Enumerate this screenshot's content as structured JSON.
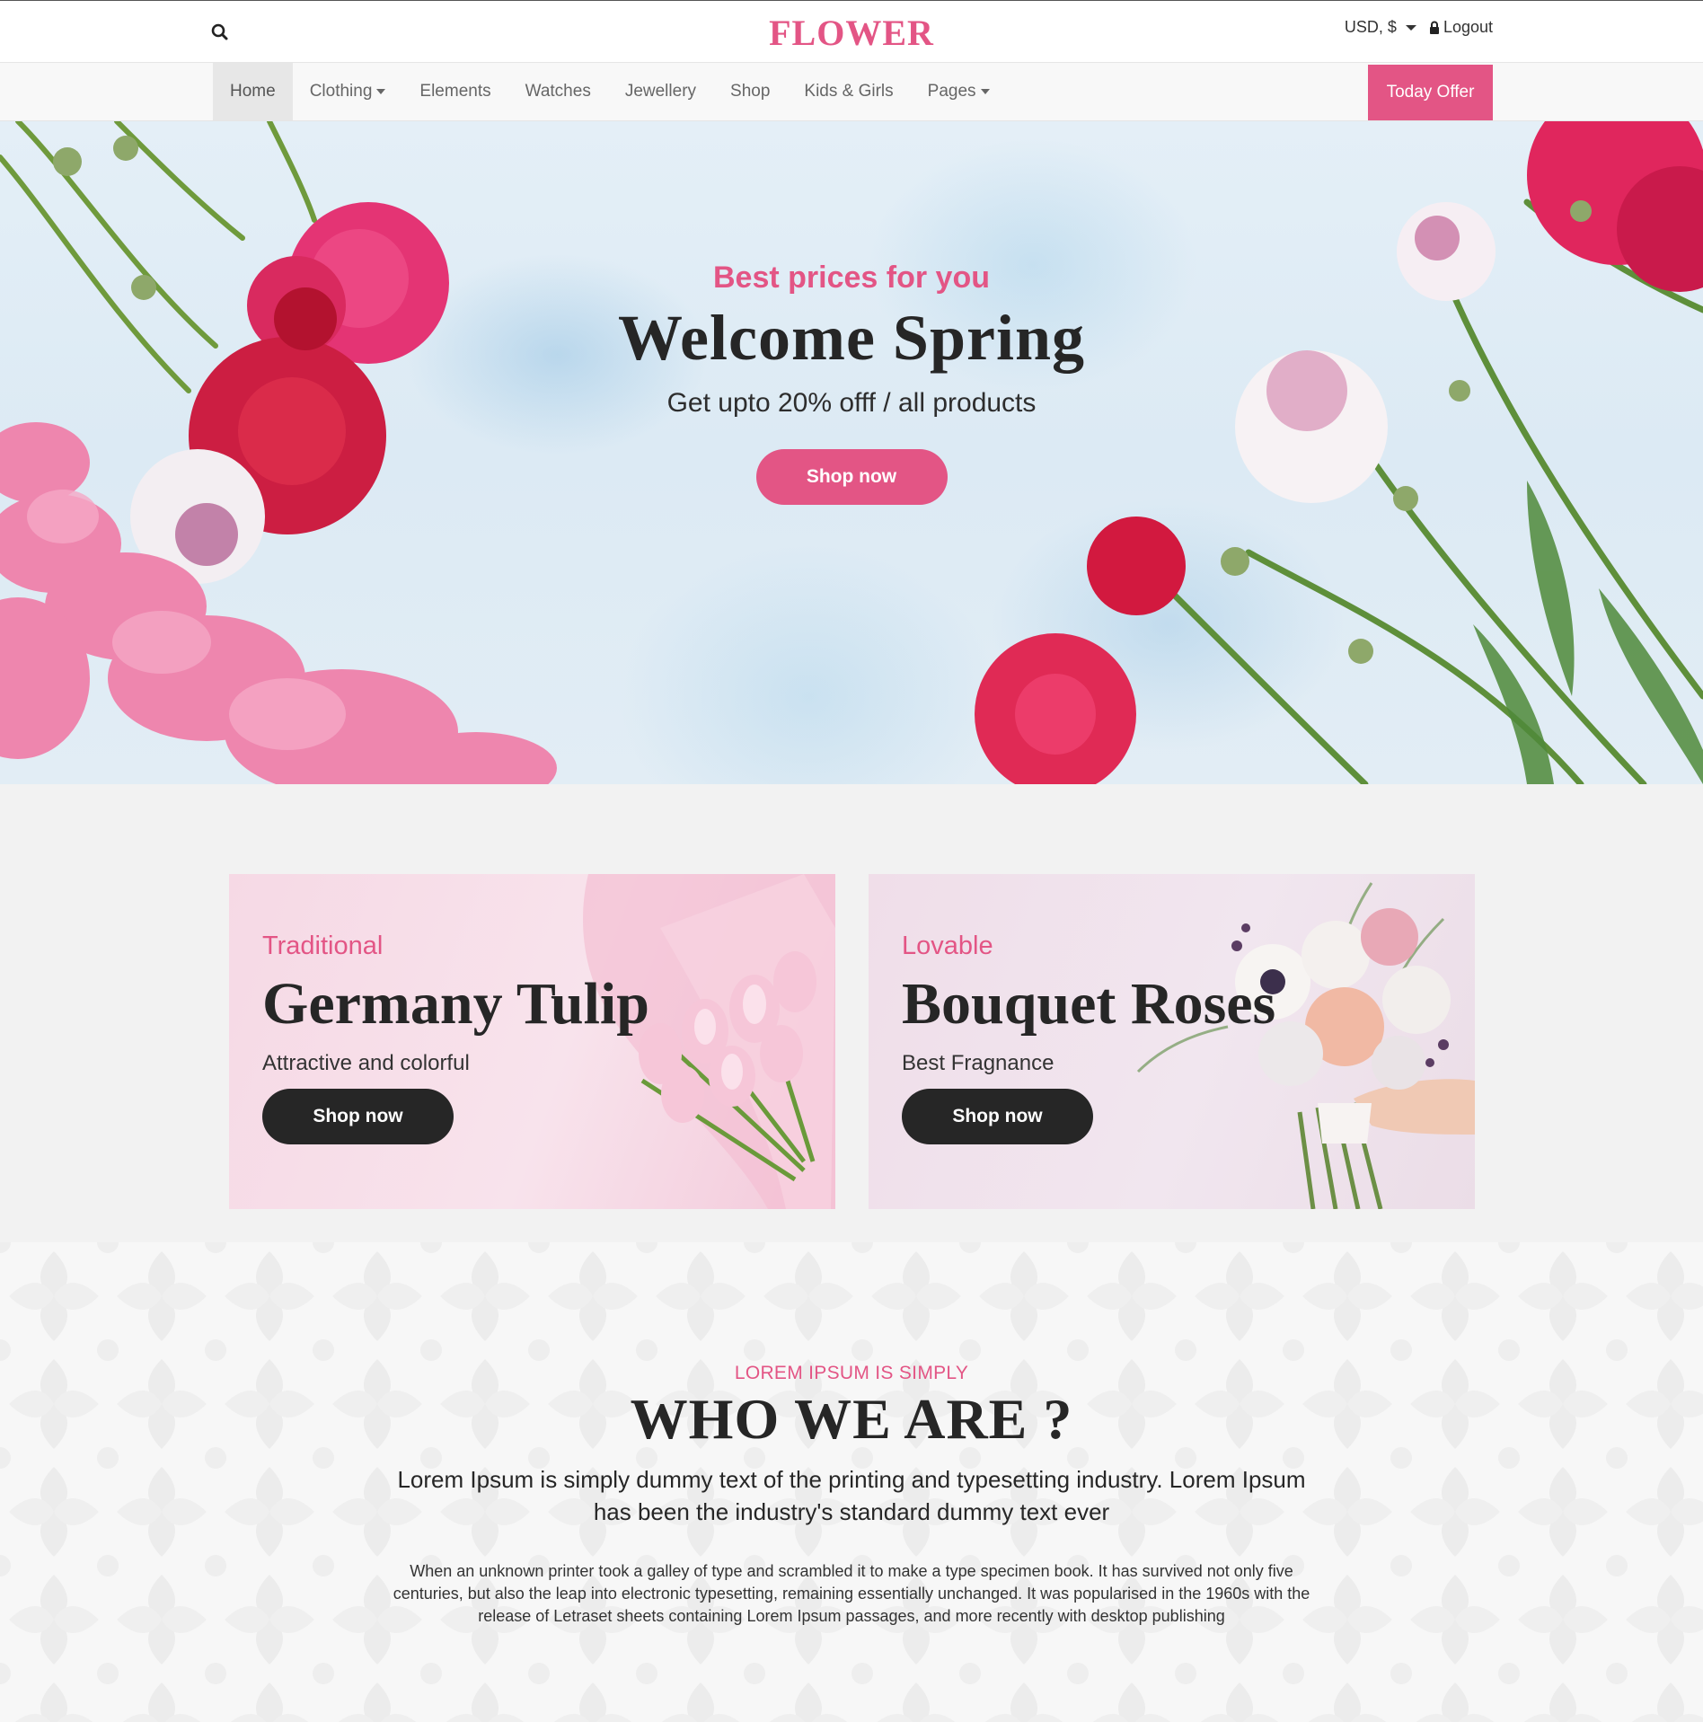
{
  "header": {
    "logo": "FLOWER",
    "currency_label": "USD, $",
    "logout_label": "Logout",
    "icons": {
      "search": "search-icon",
      "currency_dropdown": "chevron-down-icon",
      "logout": "lock-icon"
    }
  },
  "nav": {
    "items": [
      {
        "label": "Home",
        "active": true,
        "has_dropdown": false
      },
      {
        "label": "Clothing",
        "active": false,
        "has_dropdown": true
      },
      {
        "label": "Elements",
        "active": false,
        "has_dropdown": false
      },
      {
        "label": "Watches",
        "active": false,
        "has_dropdown": false
      },
      {
        "label": "Jewellery",
        "active": false,
        "has_dropdown": false
      },
      {
        "label": "Shop",
        "active": false,
        "has_dropdown": false
      },
      {
        "label": "Kids & Girls",
        "active": false,
        "has_dropdown": false
      },
      {
        "label": "Pages",
        "active": false,
        "has_dropdown": true
      }
    ],
    "offer_button": "Today Offer"
  },
  "hero": {
    "kicker": "Best prices for you",
    "title": "Welcome Spring",
    "subtitle": "Get upto 20% offf / all products",
    "button": "Shop now"
  },
  "promos": [
    {
      "kicker": "Traditional",
      "title": "Germany Tulip",
      "subtitle": "Attractive and colorful",
      "button": "Shop now"
    },
    {
      "kicker": "Lovable",
      "title": "Bouquet Roses",
      "subtitle": "Best Fragnance",
      "button": "Shop now"
    }
  ],
  "about": {
    "kicker": "LOREM IPSUM IS SIMPLY",
    "title": "WHO WE ARE ?",
    "lead": "Lorem Ipsum is simply dummy text of the printing and typesetting industry. Lorem Ipsum has been the industry's standard dummy text ever",
    "body": "When an unknown printer took a galley of type and scrambled it to make a type specimen book. It has survived not only five centuries, but also the leap into electronic typesetting, remaining essentially unchanged. It was popularised in the 1960s with the release of Letraset sheets containing Lorem Ipsum passages, and more recently with desktop publishing"
  },
  "colors": {
    "accent": "#e35585",
    "dark": "#262626",
    "nav_bg": "#f8f8f8",
    "page_bg": "#f2f2f2"
  }
}
